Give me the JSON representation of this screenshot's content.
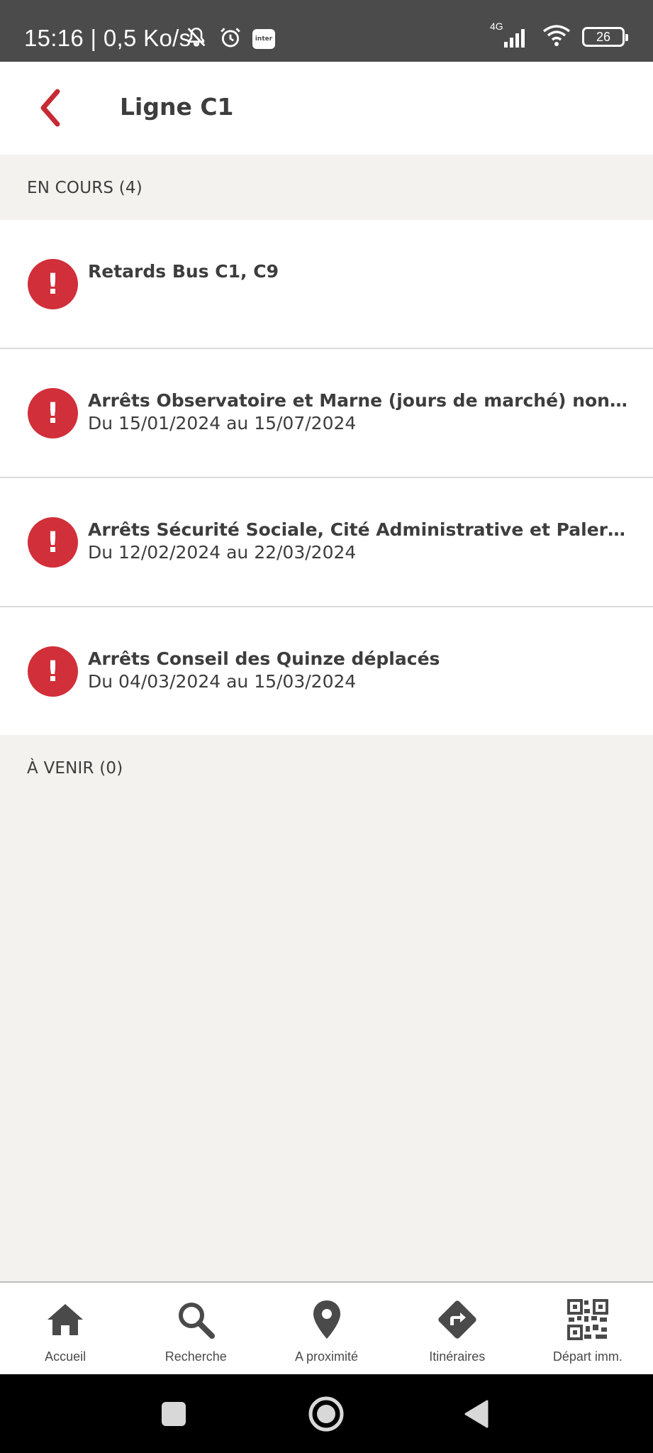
{
  "status_bar": {
    "time": "15:16 | 0,5 Ko/s",
    "inter_label": "inter",
    "network": "4G",
    "battery": "26"
  },
  "header": {
    "title": "Ligne C1"
  },
  "sections": {
    "current_label": "EN COURS (4)",
    "upcoming_label": "À VENIR (0)"
  },
  "alerts": [
    {
      "title": "Retards Bus C1, C9",
      "date": ""
    },
    {
      "title": "Arrêts Observatoire et Marne (jours de marché) non desservis",
      "date": "Du 15/01/2024 au 15/07/2024"
    },
    {
      "title": "Arrêts Sécurité Sociale, Cité Administrative et Palerme non desservis",
      "date": "Du 12/02/2024 au 22/03/2024"
    },
    {
      "title": "Arrêts Conseil des Quinze déplacés",
      "date": "Du 04/03/2024 au 15/03/2024"
    }
  ],
  "alert_icon_glyph": "!",
  "nav": [
    {
      "label": "Accueil",
      "icon": "home-icon"
    },
    {
      "label": "Recherche",
      "icon": "search-icon"
    },
    {
      "label": "A proximité",
      "icon": "location-pin-icon"
    },
    {
      "label": "Itinéraires",
      "icon": "directions-icon"
    },
    {
      "label": "Départ imm.",
      "icon": "qr-code-icon"
    }
  ],
  "colors": {
    "accent": "#c72a33",
    "alert": "#d12f39",
    "status_bar": "#4b4b4b",
    "background": "#f3f2ef"
  }
}
